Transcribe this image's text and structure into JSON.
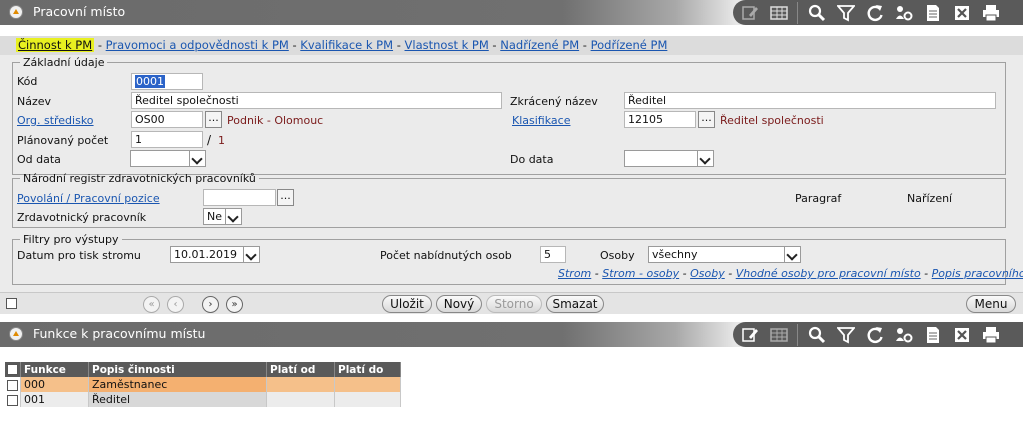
{
  "panel1": {
    "title": "Pracovní místo",
    "tabs": [
      {
        "label": "Činnost k PM",
        "active": true
      },
      {
        "label": "Pravomoci a odpovědnosti k PM"
      },
      {
        "label": "Kvalifikace k PM"
      },
      {
        "label": "Vlastnost k PM"
      },
      {
        "label": "Nadřízené PM"
      },
      {
        "label": "Podřízené PM"
      }
    ],
    "tab_separator": " - "
  },
  "basic": {
    "legend": "Základní údaje",
    "kod_label": "Kód",
    "kod_value": "0001",
    "nazev_label": "Název",
    "nazev_value": "Ředitel společnosti",
    "zkraceny_label": "Zkrácený název",
    "zkraceny_value": "Ředitel",
    "stredisko_label": "Org. středisko",
    "stredisko_value": "OS00",
    "stredisko_text": "Podnik - Olomouc",
    "klasifikace_label": "Klasifikace",
    "klasifikace_value": "12105",
    "klasifikace_text": "Ředitel společnosti",
    "planovany_label": "Plánovaný počet",
    "planovany_value": "1",
    "planovany_slash": "/",
    "planovany_total": "1",
    "od_label": "Od data",
    "od_value": "",
    "do_label": "Do data",
    "do_value": "",
    "dots": "..."
  },
  "registr": {
    "legend": "Národní registr zdravotnických pracovníků",
    "povolani_label": "Povolání / Pracovní pozice",
    "povolani_value": "",
    "paragraf_label": "Paragraf",
    "narizeni_label": "Nařízení",
    "zdrav_label": "Zrdavotnický pracovník",
    "zdrav_value": "Ne"
  },
  "filtry": {
    "legend": "Filtry pro výstupy",
    "datum_label": "Datum pro tisk stromu",
    "datum_value": "10.01.2019",
    "pocet_label": "Počet nabídnutých osob",
    "pocet_value": "5",
    "osoby_label": "Osoby",
    "osoby_value": "všechny",
    "links": [
      "Strom",
      "Strom - osoby",
      "Osoby",
      "Vhodné osoby pro pracovní místo",
      "Popis pracovního místa"
    ]
  },
  "actions": {
    "save": "Uložit",
    "new": "Nový",
    "cancel": "Storno",
    "delete": "Smazat",
    "menu": "Menu"
  },
  "panel2": {
    "title": "Funkce k pracovnímu místu",
    "columns": [
      "Funkce",
      "Popis činnosti",
      "Platí od",
      "Platí do"
    ],
    "rows": [
      {
        "funkce": "000",
        "popis": "Zaměstnanec",
        "od": "",
        "do": ""
      },
      {
        "funkce": "001",
        "popis": "Ředitel",
        "od": "",
        "do": ""
      }
    ]
  },
  "toolbar_icons": [
    "edit-icon",
    "table-icon",
    "search-icon",
    "filter-icon",
    "refresh-icon",
    "settings-icon",
    "document-icon",
    "excel-icon",
    "print-icon"
  ],
  "colors": {
    "accent": "#e08a00",
    "link": "#1a56b0",
    "active_tab": "#e8f020",
    "row_highlight": "#f5c08a"
  }
}
